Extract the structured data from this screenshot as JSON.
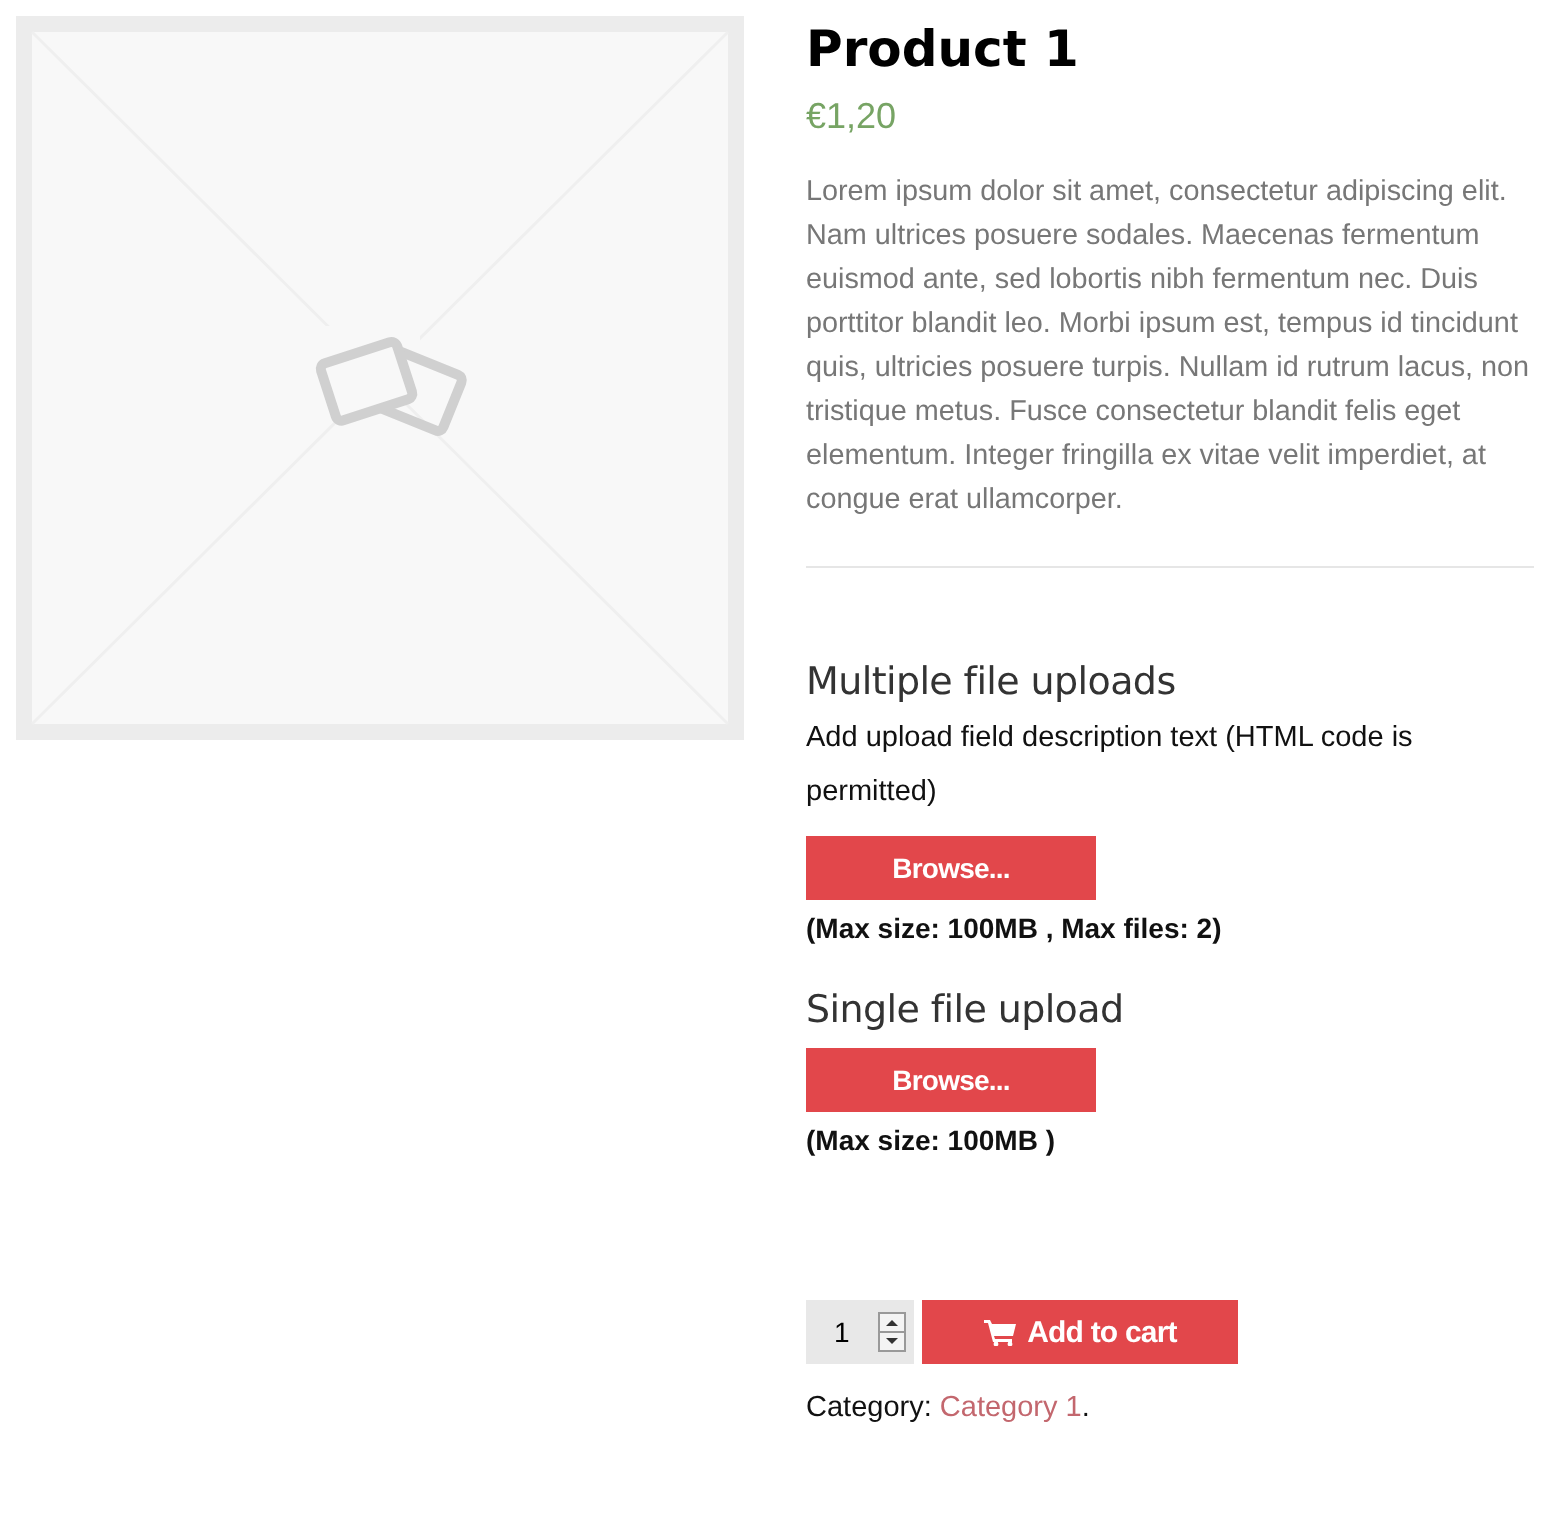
{
  "product": {
    "title": "Product 1",
    "price": "€1,20",
    "description": "Lorem ipsum dolor sit amet, consectetur adipiscing elit. Nam ultrices posuere sodales. Maecenas fermentum euismod ante, sed lobortis nibh fermentum nec. Duis porttitor blandit leo. Morbi ipsum est, tempus id tincidunt quis, ultricies posuere turpis. Nullam id rutrum lacus, non tristique metus. Fusce consectetur blandit felis eget elementum. Integer fringilla ex vitae velit imperdiet, at congue erat ullamcorper."
  },
  "uploads": [
    {
      "title": "Multiple file uploads",
      "description": "Add upload field description text (HTML code is permitted)",
      "button": "Browse...",
      "note": "(Max size: 100MB , Max files: 2)"
    },
    {
      "title": "Single file upload",
      "button": "Browse...",
      "note": "(Max size: 100MB )"
    }
  ],
  "cart": {
    "quantity": "1",
    "button": "Add to cart"
  },
  "category": {
    "label": "Category:",
    "link": "Category 1",
    "suffix": "."
  }
}
